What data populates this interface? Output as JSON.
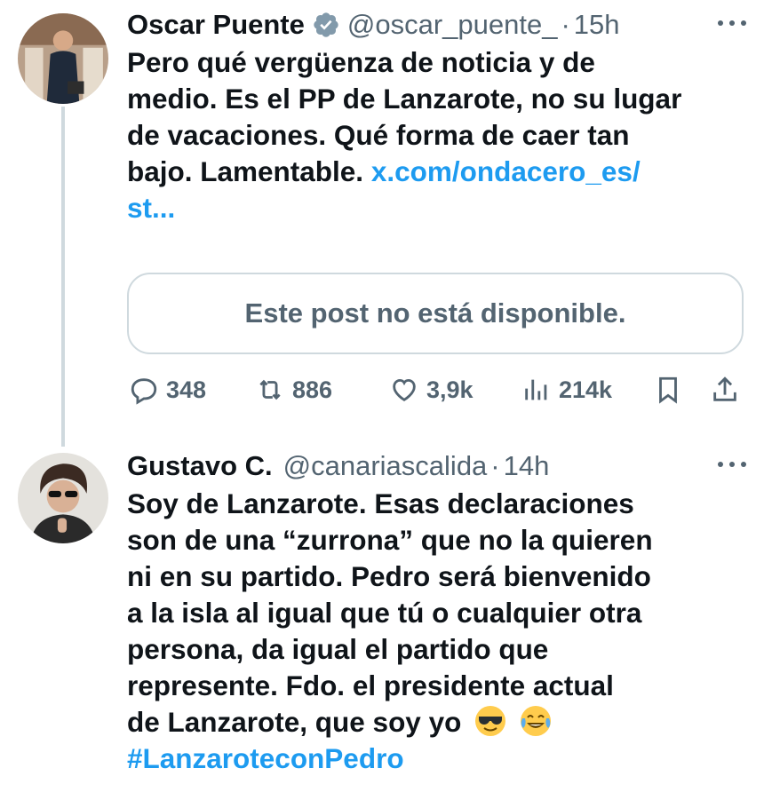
{
  "tweets": [
    {
      "name": "Oscar Puente",
      "handle": "@oscar_puente_",
      "separator": "·",
      "time": "15h",
      "text_lines": [
        "Pero qué vergüenza de noticia y de",
        "medio. Es el PP de Lanzarote, no su lugar",
        "de vacaciones. Qué forma de caer tan",
        "bajo. Lamentable. "
      ],
      "link_part1": "x.com/ondacero_es/",
      "link_part2": "st...",
      "quote_unavailable": "Este post no está disponible.",
      "replies": "348",
      "reposts": "886",
      "likes": "3,9k",
      "views": "214k"
    },
    {
      "name": "Gustavo C.",
      "handle": "@canariascalida",
      "separator": "·",
      "time": "14h",
      "text_lines": [
        "Soy de Lanzarote. Esas declaraciones",
        "son de una “zurrona” que no la quieren",
        "ni en su partido. Pedro será bienvenido",
        "a la isla al igual que tú o cualquier otra",
        "persona, da igual el partido que",
        "represente. Fdo. el presidente actual",
        "de Lanzarote, que soy yo"
      ],
      "emojis": [
        "smiling-face-with-sunglasses",
        "face-with-tears-of-joy"
      ],
      "hashtag": "#LanzaroteconPedro"
    }
  ],
  "more_label": "···",
  "colors": {
    "accent": "#1d9bf0",
    "secondary_text": "#536471",
    "border": "#cfd9de"
  }
}
